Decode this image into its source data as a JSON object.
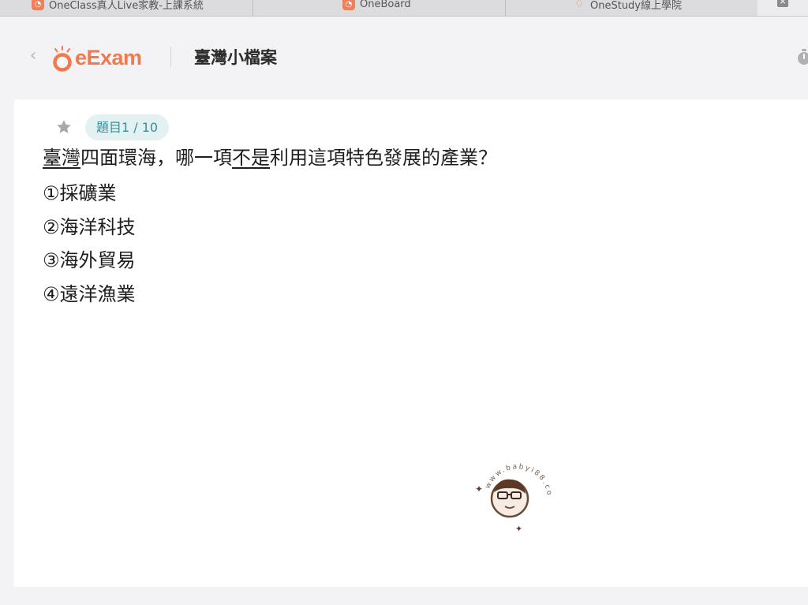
{
  "browser": {
    "tabs": [
      {
        "title": "OneClass真人Live家教-上課系統",
        "favicon": "oneclass-favicon"
      },
      {
        "title": "OneBoard",
        "favicon": "oneboard-favicon"
      },
      {
        "title": "OneStudy線上學院",
        "favicon": "onestudy-favicon"
      }
    ],
    "close_label": "×"
  },
  "header": {
    "back_icon": "chevron-left-icon",
    "logo_text": "eExam",
    "title": "臺灣小檔案",
    "timer_icon": "stopwatch-icon"
  },
  "question": {
    "badge": "題目1 / 10",
    "star_icon": "star-icon",
    "text_parts": [
      "臺灣",
      "四面環海，哪一項",
      "不是",
      "利用這項特色發展的產業？"
    ],
    "options": [
      "①採礦業",
      "②海洋科技",
      "③海外貿易",
      "④遠洋漁業"
    ]
  },
  "watermark": {
    "text": "www.babyi88.com"
  },
  "colors": {
    "brand": "#f07a4e",
    "badge_bg": "#e4f1f3",
    "badge_text": "#3a8e9a",
    "page_bg": "#f3f3f5"
  }
}
